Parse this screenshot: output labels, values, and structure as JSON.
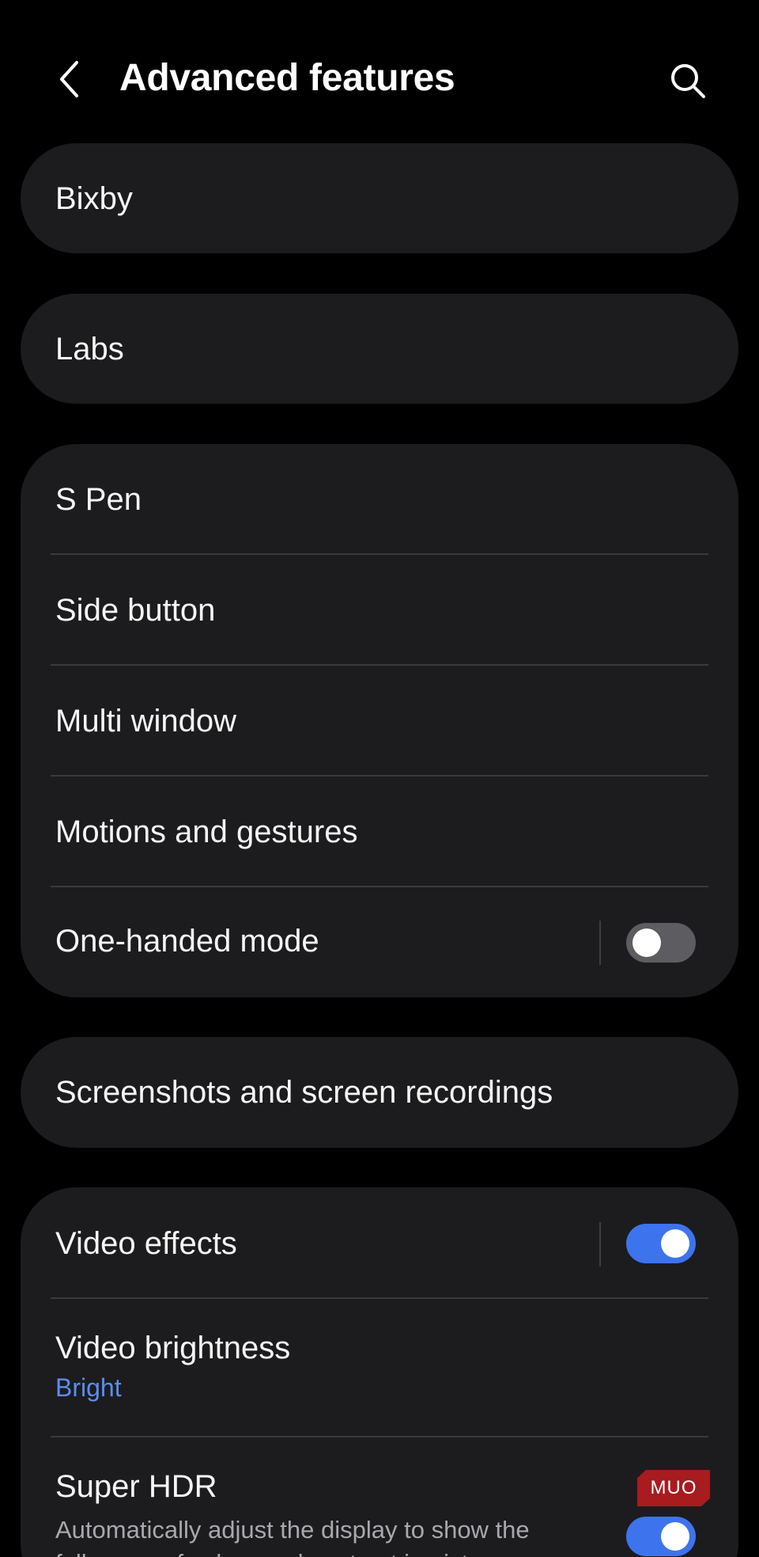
{
  "header": {
    "title": "Advanced features",
    "back_icon": "chevron-left-icon",
    "search_icon": "search-icon"
  },
  "cards": {
    "bixby": "Bixby",
    "labs": "Labs",
    "group1": {
      "s_pen": "S Pen",
      "side_button": "Side button",
      "multi_window": "Multi window",
      "motions": "Motions and gestures",
      "one_handed": "One-handed mode"
    },
    "screenshots": "Screenshots and screen recordings",
    "group2": {
      "video_effects": "Video effects",
      "video_brightness": "Video brightness",
      "video_brightness_value": "Bright",
      "super_hdr": "Super HDR",
      "super_hdr_desc": "Automatically adjust the display to show the full range of colors and contrast in pictures"
    }
  },
  "toggles": {
    "one_handed_mode": false,
    "video_effects": true,
    "super_hdr": true
  },
  "watermark": "MUO",
  "colors": {
    "background": "#000000",
    "card": "#1c1c1e",
    "accent": "#3e73ee",
    "link": "#5b8cf5",
    "watermark": "#a81b1f"
  }
}
